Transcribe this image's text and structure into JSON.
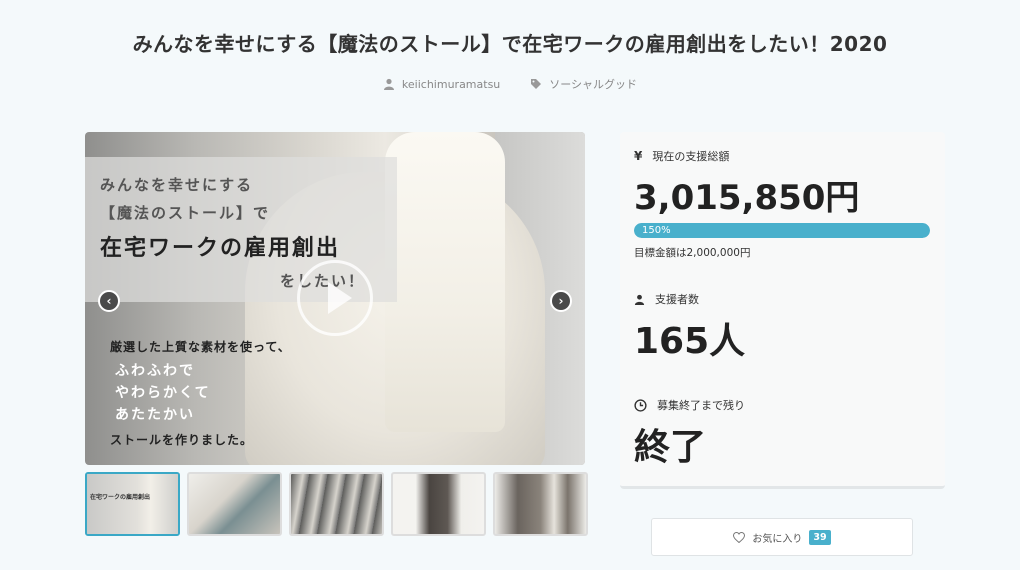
{
  "project": {
    "title": "みんなを幸せにする【魔法のストール】で在宅ワークの雇用創出をしたい！2020",
    "author": "keiichimuramatsu",
    "category": "ソーシャルグッド"
  },
  "hero": {
    "line1": "みんなを幸せにする",
    "line2": "【魔法のストール】で",
    "line3": "在宅ワークの雇用創出",
    "line4": "をしたい！",
    "line5": "厳選した上質な素材を使って、",
    "line6": "ふわふわで",
    "line7": "やわらかくて",
    "line8": "あたたかい",
    "line9": "ストールを作りました。",
    "prev_icon": "chevron-left-icon",
    "next_icon": "chevron-right-icon"
  },
  "thumbnails": [
    {
      "caption": "在宅ワークの雇用創出",
      "active": true
    },
    {
      "caption": "",
      "active": false
    },
    {
      "caption": "",
      "active": false
    },
    {
      "caption": "",
      "active": false
    },
    {
      "caption": "",
      "active": false
    }
  ],
  "stats": {
    "funding_label": "現在の支援総額",
    "funding_value": "3,015,850円",
    "progress_text": "150%",
    "progress_ratio": 1.0,
    "goal_text": "目標金額は2,000,000円",
    "backers_label": "支援者数",
    "backers_value": "165人",
    "remaining_label": "募集終了まで残り",
    "remaining_value": "終了"
  },
  "favorite": {
    "label": "お気に入り",
    "count": "39"
  },
  "colors": {
    "accent": "#49b0cc",
    "background": "#f4f9fb"
  }
}
